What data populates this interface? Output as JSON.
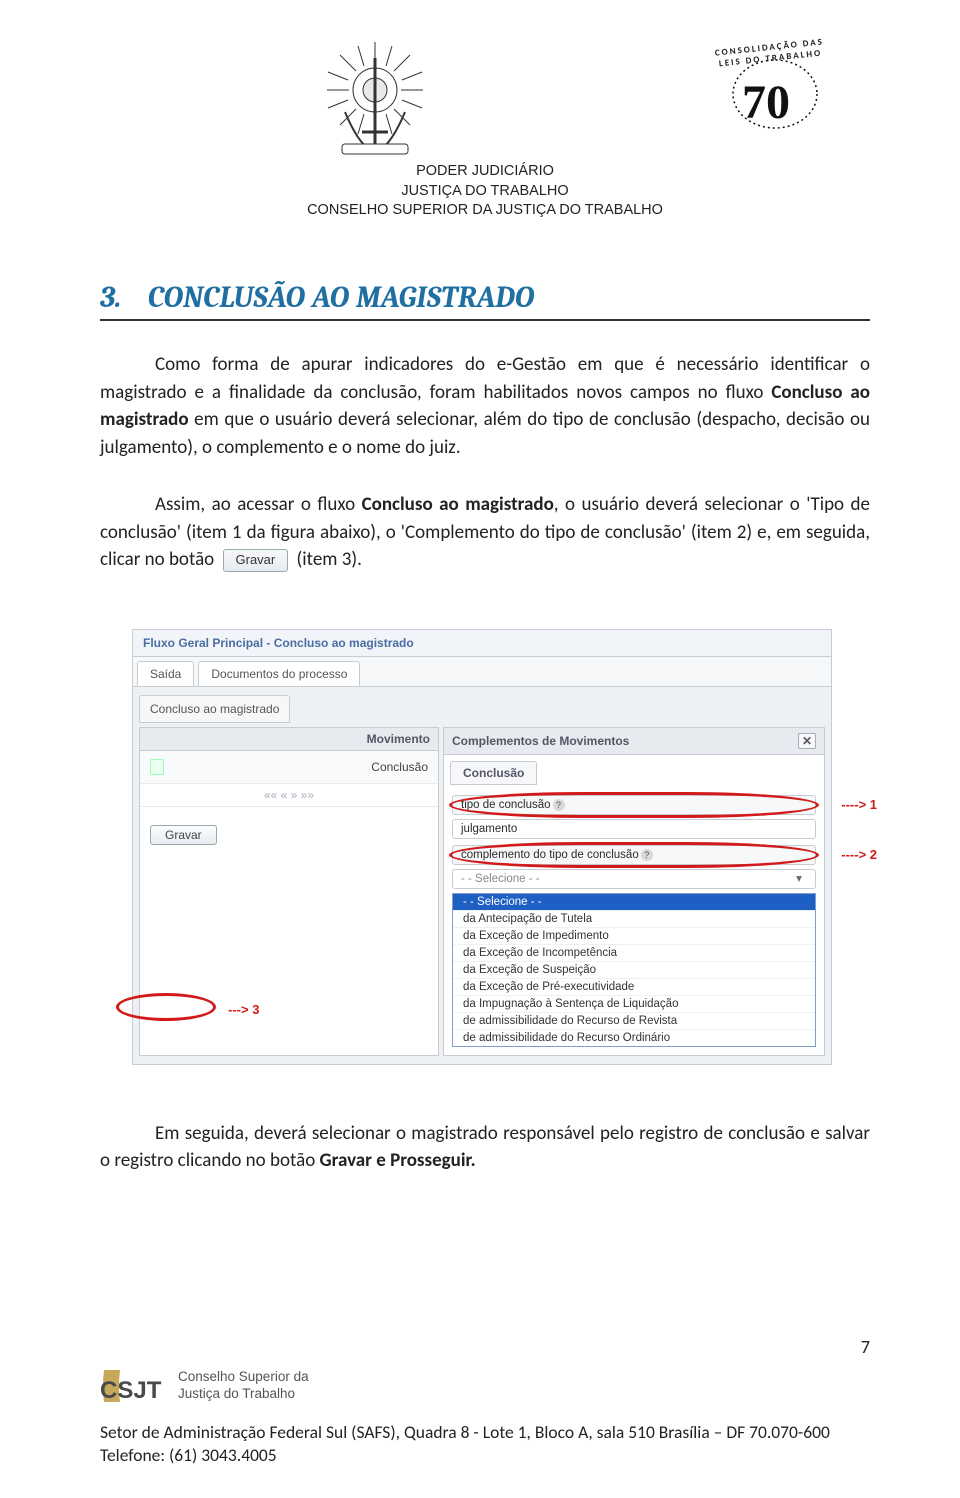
{
  "header": {
    "line1": "PODER JUDICIÁRIO",
    "line2": "JUSTIÇA DO TRABALHO",
    "line3": "CONSELHO SUPERIOR DA JUSTIÇA DO TRABALHO",
    "logo70_arc": "CONSOLIDAÇÃO DAS LEIS DO TRABALHO",
    "logo70_number": "70"
  },
  "section": {
    "number": "3.",
    "title": "CONCLUSÃO AO MAGISTRADO"
  },
  "paragraphs": {
    "p1_a": "Como forma de apurar indicadores do e-Gestão em que é necessário identificar o magistrado e a finalidade da conclusão, foram habilitados novos campos no fluxo ",
    "p1_b_bold": "Concluso ao magistrado",
    "p1_c": " em que o usuário deverá selecionar, além do tipo de conclusão (despacho, decisão ou julgamento), o complemento e o nome do juiz.",
    "p2_a": "Assim, ao acessar o fluxo ",
    "p2_b_bold": "Concluso ao magistrado",
    "p2_c": ", o usuário deverá selecionar o 'Tipo de conclusão' (item 1 da figura abaixo), o 'Complemento do tipo de conclusão' (item 2) e, em seguida, clicar no botão ",
    "gravar_chip": "Gravar",
    "p2_d": " (item 3).",
    "p3": "Em seguida, deverá selecionar o magistrado responsável pelo registro de conclusão e salvar o registro clicando no botão ",
    "p3_bold": "Gravar e Prosseguir."
  },
  "screenshot": {
    "flow_title": "Fluxo Geral Principal - Concluso ao magistrado",
    "tab_saida": "Saída",
    "tab_docs": "Documentos do processo",
    "subtab": "Concluso ao magistrado",
    "mov_header_left": ".",
    "mov_header_right": "Movimento",
    "mov_row_value": "Conclusão",
    "pager": "««   «   »   »»",
    "gravar_btn": "Gravar",
    "ann3": "---> 3",
    "right_title": "Complementos de Movimentos",
    "conc_tab": "Conclusão",
    "field1_label": "tipo de conclusão",
    "field1_value": "julgamento",
    "ann1": "----> 1",
    "field2_label": "complemento do tipo de conclusão",
    "ann2": "----> 2",
    "placeholder1": "- - Selecione - -",
    "options": [
      "- - Selecione - -",
      "da Antecipação de Tutela",
      "da Exceção de Impedimento",
      "da Exceção de Incompetência",
      "da Exceção de Suspeição",
      "da Exceção de Pré-executividade",
      "da Impugnação à Sentença de Liquidação",
      "de admissibilidade do Recurso de Revista",
      "de admissibilidade do Recurso Ordinário"
    ]
  },
  "footer": {
    "page_number": "7",
    "csjt_line1": "Conselho Superior da",
    "csjt_line2": "Justiça do Trabalho",
    "csjt_acronym": "CSJT",
    "address": "Setor de Administração Federal Sul (SAFS), Quadra 8 - Lote 1, Bloco A, sala 510 Brasília – DF 70.070-600",
    "phone": "Telefone: (61) 3043.4005"
  }
}
